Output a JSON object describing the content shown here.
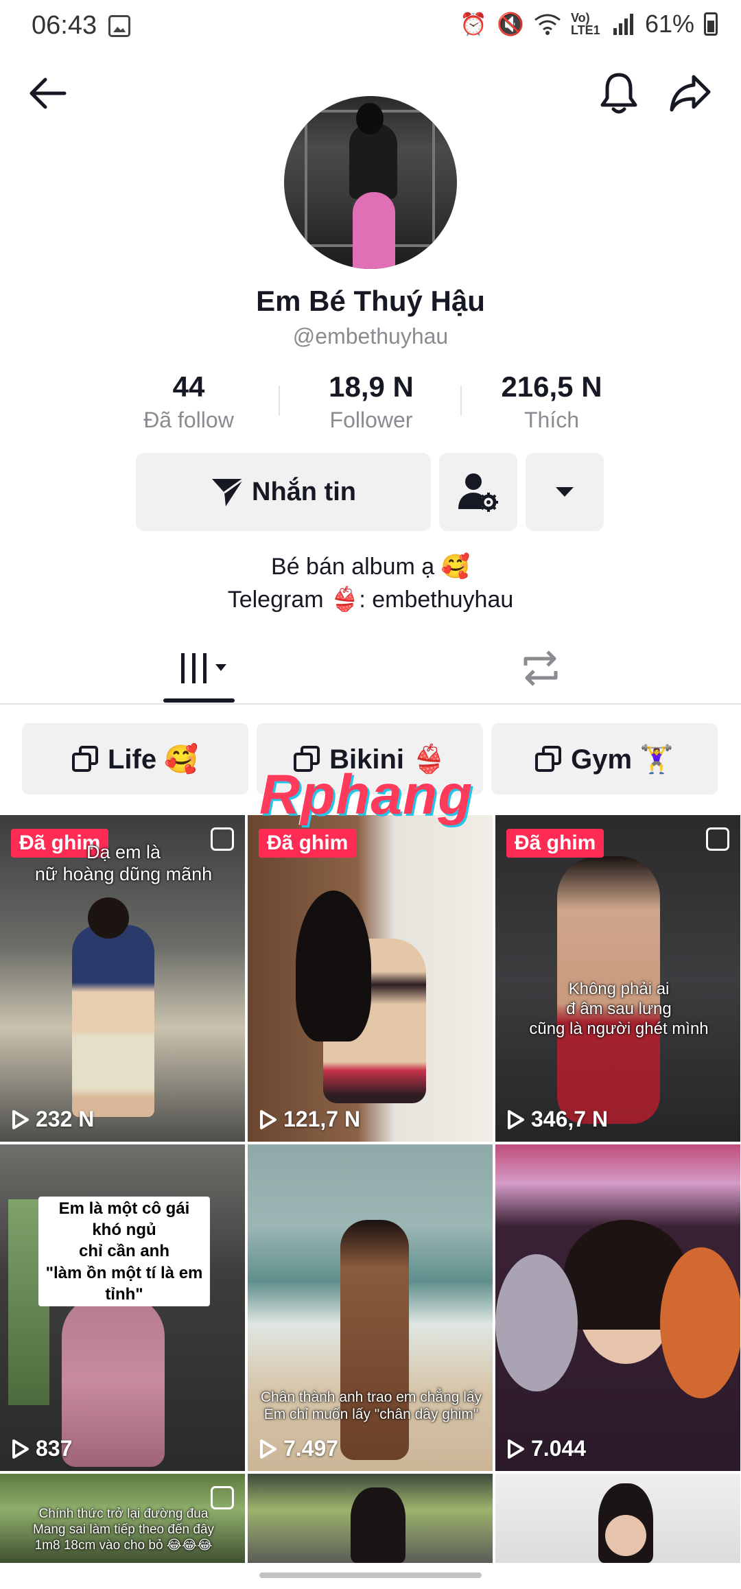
{
  "status_bar": {
    "time": "06:43",
    "battery": "61%",
    "network": "Vo) LTE1"
  },
  "nav": {
    "back_icon": "arrow-left-icon",
    "bell_icon": "bell-icon",
    "share_icon": "share-icon"
  },
  "profile": {
    "name": "Em Bé Thuý Hậu",
    "handle": "@embethuyhau",
    "stats": [
      {
        "value": "44",
        "label": "Đã follow"
      },
      {
        "value": "18,9 N",
        "label": "Follower"
      },
      {
        "value": "216,5 N",
        "label": "Thích"
      }
    ],
    "message_button": "Nhắn tin",
    "bio_line1": "Bé bán album ạ 🥰",
    "bio_line2": "Telegram 👙: embethuyhau"
  },
  "tabs": [
    {
      "icon": "grid-icon",
      "active": true
    },
    {
      "icon": "repost-icon",
      "active": false
    }
  ],
  "playlists": [
    {
      "label": "Life 🥰"
    },
    {
      "label": "Bikini 👙"
    },
    {
      "label": "Gym 🏋️‍♀️"
    }
  ],
  "watermark": "Rphang",
  "videos": [
    {
      "pinned": "Đã ghim",
      "views": "232 N",
      "caption": "Dạ em là\nnữ hoàng dũng mãnh"
    },
    {
      "pinned": "Đã ghim",
      "views": "121,7 N",
      "caption": ""
    },
    {
      "pinned": "Đã ghim",
      "views": "346,7 N",
      "caption": "Không phải ai\nđ âm sau lưng\ncũng là người ghét mình"
    },
    {
      "pinned": "",
      "views": "837",
      "caption": "Em là một cô gái khó ngủ\nchỉ cần anh\n\"làm ồn một tí là em tỉnh\""
    },
    {
      "pinned": "",
      "views": "7.497",
      "caption": "Chân thành anh trao em chẳng lấy\nEm chỉ muốn lấy \"chân dây ghim\""
    },
    {
      "pinned": "",
      "views": "7.044",
      "caption": ""
    },
    {
      "pinned": "",
      "views": "",
      "caption": "Chính thức trở lại đường đua\nMang sai làm tiếp theo đến đây\n1m8 18cm vào cho bỏ 😂😂😂"
    },
    {
      "pinned": "",
      "views": "",
      "caption": ""
    },
    {
      "pinned": "",
      "views": "",
      "caption": ""
    }
  ],
  "colors": {
    "accent": "#fe2c55",
    "text": "#161823",
    "muted": "#8a8b91",
    "button_bg": "#f1f1f2"
  }
}
